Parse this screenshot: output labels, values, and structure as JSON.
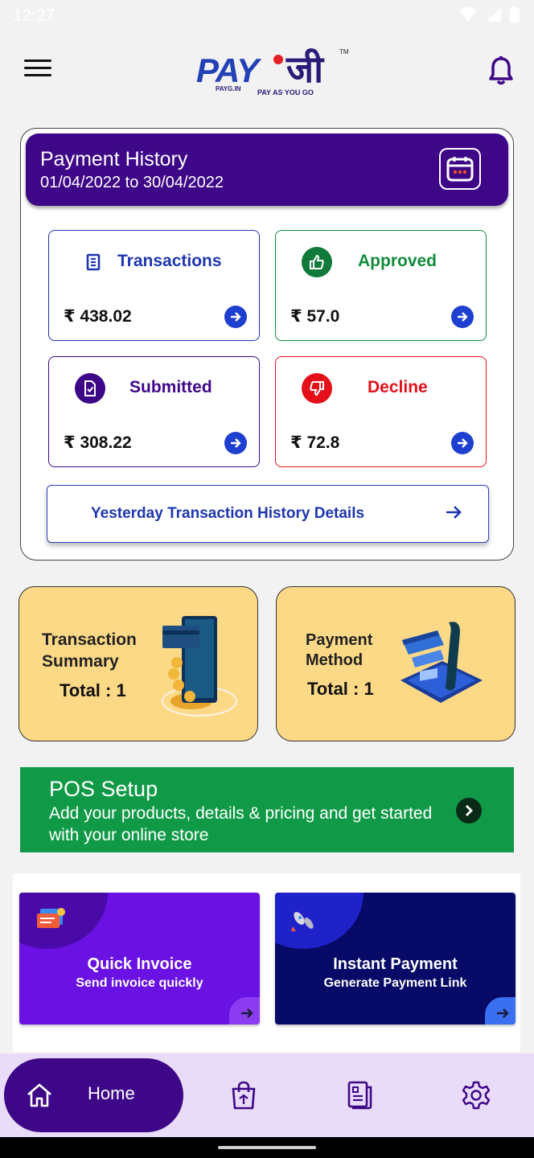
{
  "status_bar": {
    "time": "12:27"
  },
  "header": {
    "logo_pay": "PAY",
    "logo_ji": "जी",
    "logo_tm": "TM",
    "logo_tag_small": "PAYG.IN",
    "logo_tagline": "PAY AS YOU GO"
  },
  "payment_history": {
    "title": "Payment History",
    "date_range": "01/04/2022 to 30/04/2022",
    "stats": [
      {
        "label": "Transactions",
        "amount": "₹ 438.02",
        "color": "#1e36b0"
      },
      {
        "label": "Approved",
        "amount": "₹ 57.0",
        "color": "#138a3c"
      },
      {
        "label": "Submitted",
        "amount": "₹ 308.22",
        "color": "#3e0787"
      },
      {
        "label": "Decline",
        "amount": "₹ 72.8",
        "color": "#e3101a"
      }
    ],
    "yesterday_label": "Yesterday Transaction History Details"
  },
  "tiles": {
    "transaction_summary": {
      "line1": "Transaction",
      "line2": "Summary",
      "total": "Total : 1"
    },
    "payment_method": {
      "line1": "Payment",
      "line2": "Method",
      "total": "Total : 1"
    }
  },
  "pos_setup": {
    "title": "POS Setup",
    "description": "Add your products, details & pricing and get started with your online store"
  },
  "quick_actions": [
    {
      "title": "Quick Invoice",
      "subtitle": "Send invoice quickly",
      "bg": "#6a12e3",
      "blob": "#4a0aa8"
    },
    {
      "title": "Instant Payment",
      "subtitle": "Generate Payment Link",
      "bg": "#070a66",
      "blob": "#1e22c8"
    }
  ],
  "bottom_nav": {
    "home_label": "Home"
  },
  "colors": {
    "primary": "#3e0787",
    "accent_blue": "#1e3fd0",
    "tile": "#fcd987",
    "pos_green": "#109a48"
  }
}
